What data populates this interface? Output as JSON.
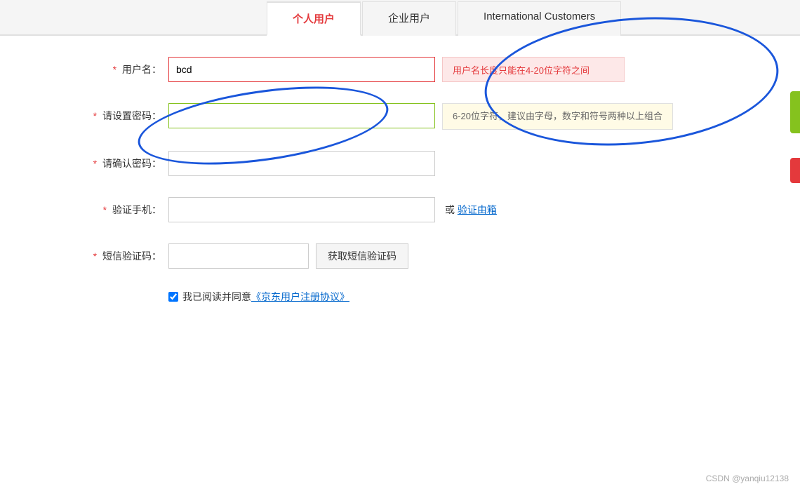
{
  "tabs": [
    {
      "id": "personal",
      "label": "个人用户",
      "active": true
    },
    {
      "id": "enterprise",
      "label": "企业用户",
      "active": false
    },
    {
      "id": "international",
      "label": "International Customers",
      "active": false
    }
  ],
  "form": {
    "username": {
      "label": "用户名：",
      "required": "* ",
      "value": "bcd",
      "error": "用户名长度只能在4-20位字符之间"
    },
    "password": {
      "label": "请设置密码：",
      "required": "* ",
      "value": "",
      "hint": "6-20位字符，建议由字母，数字和符号两种以上组合"
    },
    "confirm_password": {
      "label": "请确认密码：",
      "required": "* ",
      "value": ""
    },
    "phone": {
      "label": "验证手机：",
      "required": "* ",
      "value": "",
      "or_text": "或",
      "verify_link": "验证由箱"
    },
    "sms_code": {
      "label": "短信验证码：",
      "required": "* ",
      "value": "",
      "btn_label": "获取短信验证码"
    },
    "agree": {
      "checked": true,
      "label": "我已阅读并同意《京东用户注册协议》"
    }
  },
  "watermark": "CSDN @yanqiu12138"
}
